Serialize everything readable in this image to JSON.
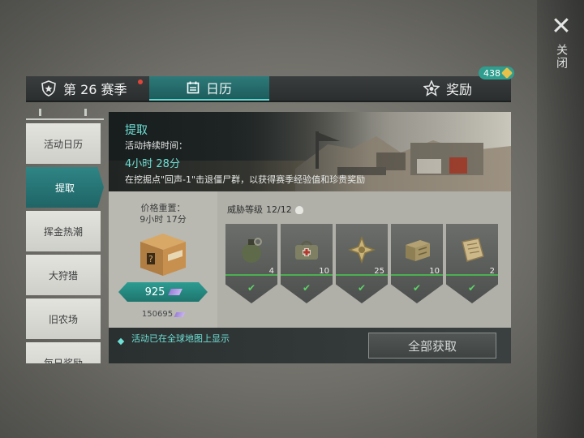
{
  "close": {
    "label": "关闭"
  },
  "tabs": {
    "season": "第 26 赛季",
    "calendar": "日历",
    "rewards": "奖励",
    "badge": "438"
  },
  "sidebar": {
    "items": [
      {
        "label": "活动日历"
      },
      {
        "label": "提取"
      },
      {
        "label": "挥金热潮"
      },
      {
        "label": "大狩猎"
      },
      {
        "label": "旧农场"
      },
      {
        "label": "每日奖励"
      }
    ],
    "active_index": 1
  },
  "event": {
    "title": "提取",
    "duration_label": "活动持续时间：",
    "duration": "4小时 28分",
    "description": "在挖掘点\"回声-1\"击退僵尸群，以获得赛季经验值和珍贵奖励"
  },
  "crate": {
    "reset_label": "价格重置：",
    "reset_time": "9小时 17分",
    "price": "925",
    "balance": "150695"
  },
  "threat": {
    "label": "威胁等级",
    "value": "12/12"
  },
  "rewards": [
    {
      "icon": "grenade-icon",
      "count": "4"
    },
    {
      "icon": "medkit-bag-icon",
      "count": "10"
    },
    {
      "icon": "scrap-metal-icon",
      "count": "25"
    },
    {
      "icon": "ammo-crate-icon",
      "count": "10"
    },
    {
      "icon": "blueprint-icon",
      "count": "2"
    }
  ],
  "footer": {
    "map_notice": "活动已在全球地图上显示",
    "claim_all": "全部获取"
  },
  "colors": {
    "accent": "#2f8585",
    "highlight": "#6fe0d6",
    "check": "#5fd069"
  }
}
